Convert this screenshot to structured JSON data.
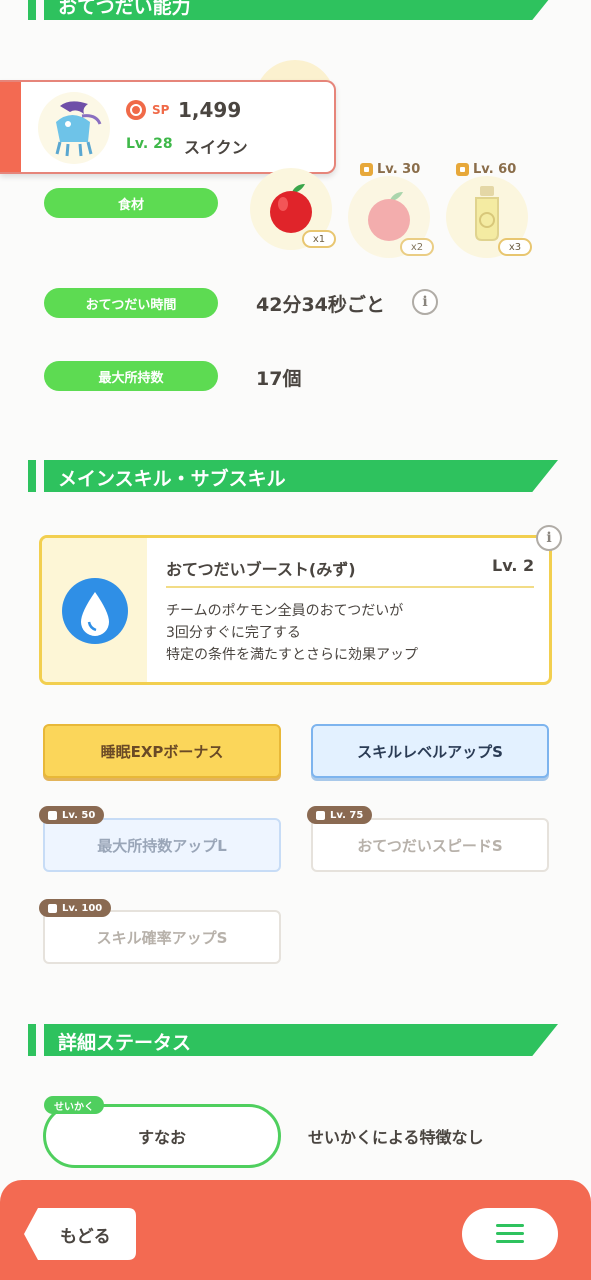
{
  "sections": {
    "skill_ability": "おてつだい能力",
    "main_sub_skill": "メインスキル・サブスキル",
    "detail_status": "詳細ステータス"
  },
  "pokemon": {
    "sp_label": "SP",
    "sp_value": "1,499",
    "level": "Lv. 28",
    "name": "スイクン"
  },
  "ability": {
    "ingredients_label": "食材",
    "ingredients": [
      {
        "name": "apple",
        "qty": "x1",
        "unlock": ""
      },
      {
        "name": "apple",
        "qty": "x2",
        "unlock": "Lv. 30"
      },
      {
        "name": "oil",
        "qty": "x3",
        "unlock": "Lv. 60"
      }
    ],
    "help_time_label": "おてつだい時間",
    "help_time_value": "42分34秒ごと",
    "max_carry_label": "最大所持数",
    "max_carry_value": "17個"
  },
  "main_skill": {
    "name": "おてつだいブースト(みず)",
    "level": "Lv. 2",
    "desc_line1": "チームのポケモン全員のおてつだいが",
    "desc_line2": "3回分すぐに完了する",
    "desc_line3": "特定の条件を満たすとさらに効果アップ"
  },
  "sub_skills": [
    {
      "label": "睡眠EXPボーナス",
      "lock": ""
    },
    {
      "label": "スキルレベルアップS",
      "lock": ""
    },
    {
      "label": "最大所持数アップL",
      "lock": "Lv. 50"
    },
    {
      "label": "おてつだいスピードS",
      "lock": "Lv. 75"
    },
    {
      "label": "スキル確率アップS",
      "lock": "Lv. 100"
    }
  ],
  "nature": {
    "tag": "せいかく",
    "value": "すなお",
    "effect": "せいかくによる特徴なし"
  },
  "footer": {
    "back_label": "もどる"
  },
  "icons": {
    "info": "i",
    "menu": "hamburger-icon"
  },
  "colors": {
    "accent_green": "#2ec25e",
    "pill_green": "#5ddb52",
    "footer_orange": "#f36a52",
    "skill_border": "#f2cf4f",
    "water_blue": "#2f8fe6"
  }
}
